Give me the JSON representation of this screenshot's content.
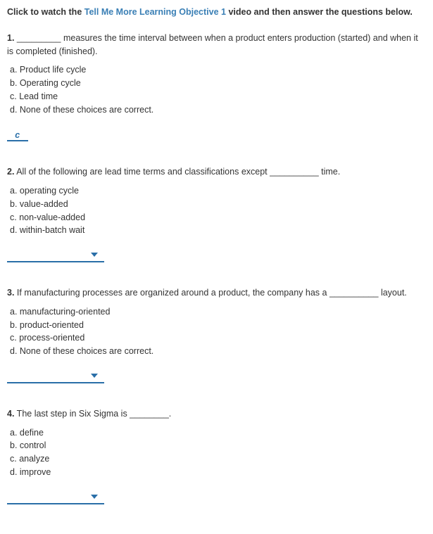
{
  "intro": {
    "prefix": "Click to watch the ",
    "link": "Tell Me More Learning Objective 1",
    "suffix": " video and then answer the questions below."
  },
  "questions": [
    {
      "num": "1.",
      "text_after": " measures the time interval between when a product enters production (started) and when it is completed (finished).",
      "blank": "_________",
      "choices": [
        "a.  Product life cycle",
        "b.  Operating cycle",
        "c.  Lead time",
        "d.  None of these choices are correct."
      ],
      "answer": "c",
      "show_chevron": false
    },
    {
      "num": "2.",
      "text_before": " All of the following are lead time terms and classifications except ",
      "blank": "__________",
      "text_after": " time.",
      "choices": [
        "a.  operating cycle",
        "b.  value-added",
        "c.  non-value-added",
        "d.  within-batch wait"
      ],
      "answer": "",
      "show_chevron": true
    },
    {
      "num": "3.",
      "text_before": " If manufacturing processes are organized around a product, the company has a ",
      "blank": "__________",
      "text_after": " layout.",
      "choices": [
        "a.  manufacturing-oriented",
        "b.  product-oriented",
        "c.  process-oriented",
        "d.  None of these choices are correct."
      ],
      "answer": "",
      "show_chevron": true
    },
    {
      "num": "4.",
      "text_before": " The last step in Six Sigma is ",
      "blank": "________",
      "text_after": ".",
      "choices": [
        "a.  define",
        "b.  control",
        "c.  analyze",
        "d.  improve"
      ],
      "answer": "",
      "show_chevron": true
    }
  ]
}
